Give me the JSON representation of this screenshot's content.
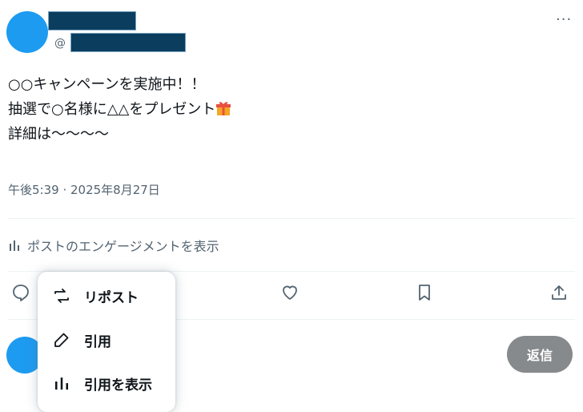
{
  "author": {
    "handle_prefix": "@"
  },
  "more_label": "···",
  "post": {
    "lines": [
      "○○キャンペーンを実施中！！",
      "抽選で○名様に△△をプレゼント",
      "",
      "詳細は〜〜〜〜"
    ],
    "gift_icon": "gift-emoji",
    "timestamp": "午後5:39 · 2025年8月27日"
  },
  "engagement": {
    "label": "ポストのエンゲージメントを表示",
    "icon": "bar-chart-icon"
  },
  "actions": [
    "reply-icon",
    "repost-icon",
    "like-icon",
    "bookmark-icon",
    "share-icon"
  ],
  "repost_menu": {
    "items": [
      {
        "label": "リポスト",
        "icon": "repost-icon"
      },
      {
        "label": "引用",
        "icon": "pencil-icon"
      },
      {
        "label": "引用を表示",
        "icon": "bar-chart-icon"
      }
    ]
  },
  "reply": {
    "button_label": "返信"
  },
  "colors": {
    "accent": "#1d9bf0",
    "text": "#0f1419",
    "secondary": "#536471",
    "reply_button": "#878a8c"
  }
}
